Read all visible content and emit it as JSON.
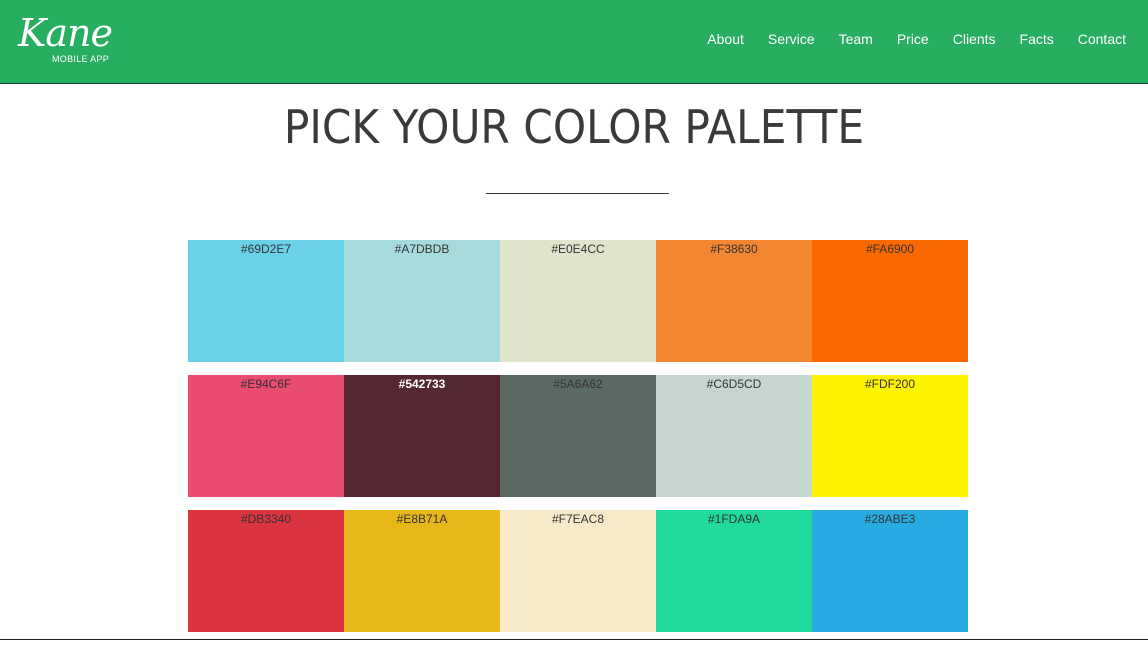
{
  "brand": {
    "logo_text": "Kane",
    "logo_sub": "MOBILE APP",
    "header_color": "#27AE60"
  },
  "nav": {
    "items": [
      "About",
      "Service",
      "Team",
      "Price",
      "Clients",
      "Facts",
      "Contact"
    ]
  },
  "page": {
    "title": "PICK YOUR COLOR PALETTE"
  },
  "palette": {
    "rows": [
      [
        {
          "label": "#69D2E7",
          "color": "#69D2E7"
        },
        {
          "label": "#A7DBDB",
          "color": "#A7DBDB"
        },
        {
          "label": "#E0E4CC",
          "color": "#E0E4CC"
        },
        {
          "label": "#F38630",
          "color": "#F38630"
        },
        {
          "label": "#FA6900",
          "color": "#FA6900"
        }
      ],
      [
        {
          "label": "#E94C6F",
          "color": "#E94C6F"
        },
        {
          "label": "#542733",
          "color": "#542733"
        },
        {
          "label": "#5A6A62",
          "color": "#5A6A62"
        },
        {
          "label": "#C6D5CD",
          "color": "#C6D5CD"
        },
        {
          "label": "#FDF200",
          "color": "#FDF200"
        }
      ],
      [
        {
          "label": "#DB3340",
          "color": "#DB3340"
        },
        {
          "label": "#E8B71A",
          "color": "#E8B71A"
        },
        {
          "label": "#F7EAC8",
          "color": "#F7EAC8"
        },
        {
          "label": "#1FDA9A",
          "color": "#1FDA9A"
        },
        {
          "label": "#28ABE3",
          "color": "#28ABE3"
        }
      ]
    ]
  }
}
